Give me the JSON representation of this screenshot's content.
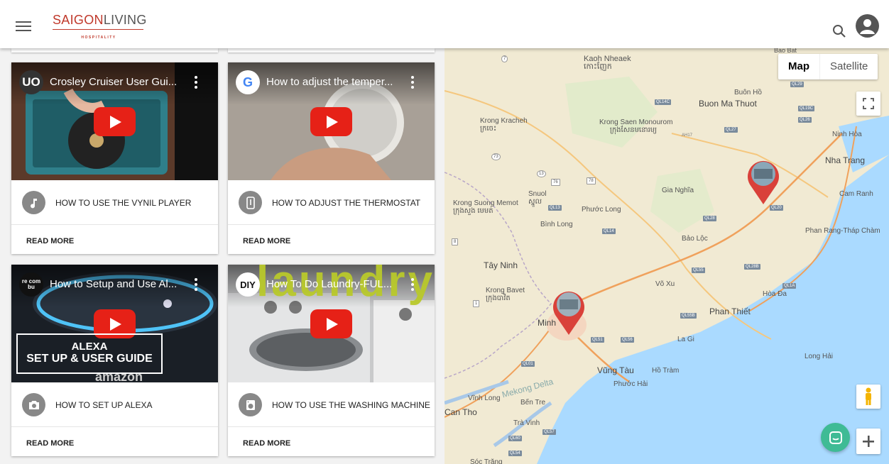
{
  "header": {
    "logo_main_red": "SAIGON",
    "logo_main_rest": "LIVING",
    "logo_sub": "HOSPITALITY"
  },
  "cards": [
    {
      "video_title": "Crosley Cruiser User Gui...",
      "channel_logo": "UO",
      "label": "HOW TO USE THE VYNIL PLAYER",
      "icon": "music-note-icon",
      "read_more": "READ MORE"
    },
    {
      "video_title": "How to adjust the temper...",
      "channel_logo": "G",
      "label": "HOW TO ADJUST THE THERMOSTAT",
      "icon": "thermostat-icon",
      "read_more": "READ MORE"
    },
    {
      "video_title": "How to Setup and Use Al...",
      "channel_logo": "re com bu",
      "overlay_line1": "ALEXA",
      "overlay_line2": "SET UP & USER GUIDE",
      "overlay_brand": "amazon",
      "label": "HOW TO SET UP ALEXA",
      "icon": "camera-icon",
      "read_more": "READ MORE"
    },
    {
      "video_title": "How To Do Laundry-FUL...",
      "channel_logo": "DIY",
      "overlay_word": "laundry",
      "label": "HOW TO USE THE WASHING MACHINE",
      "icon": "washing-machine-icon",
      "read_more": "READ MORE"
    }
  ],
  "map": {
    "type_map": "Map",
    "type_satellite": "Satellite",
    "places": [
      {
        "name": "Kaoh Nheaek",
        "sub": "កោះញែក"
      },
      {
        "name": "Buôn Hồ"
      },
      {
        "name": "Buon Ma Thuot"
      },
      {
        "name": "Krong Kracheh",
        "sub": "ក្រចេះ"
      },
      {
        "name": "Krong Saen Monourom",
        "sub": "ក្រុងសែនមនោរម្យ"
      },
      {
        "name": "Ninh Hòa"
      },
      {
        "name": "Nha Trang"
      },
      {
        "name": "Gia Nghĩa"
      },
      {
        "name": "Snuol",
        "sub": "ស្នួល"
      },
      {
        "name": "Krong Suong Memot",
        "sub": "ក្រុងសួង មេមត់"
      },
      {
        "name": "Phước Long"
      },
      {
        "name": "Cam Ranh"
      },
      {
        "name": "Bình Long"
      },
      {
        "name": "Bảo Lộc"
      },
      {
        "name": "Phan Rang-Tháp Chàm"
      },
      {
        "name": "Tây Ninh"
      },
      {
        "name": "Võ Xu"
      },
      {
        "name": "Krong Bavet",
        "sub": "ក្រុងបាវិត"
      },
      {
        "name": "Hòa Đa"
      },
      {
        "name": "Phan Thiết"
      },
      {
        "name": "Minh"
      },
      {
        "name": "La Gi"
      },
      {
        "name": "Long Hải"
      },
      {
        "name": "Vũng Tàu"
      },
      {
        "name": "Hồ Tràm"
      },
      {
        "name": "Phước Hải"
      },
      {
        "name": "Vĩnh Long"
      },
      {
        "name": "Mekong Delta"
      },
      {
        "name": "Bến Tre"
      },
      {
        "name": "Can Tho"
      },
      {
        "name": "Trà Vinh"
      },
      {
        "name": "Bao Bat"
      },
      {
        "name": "Sóc Trăng"
      }
    ],
    "roads": [
      "QL14C",
      "QL19C",
      "QL26",
      "QL27",
      "QL29",
      "AH17",
      "QL13",
      "QL14",
      "QL28",
      "QL20",
      "QL55",
      "QL28B",
      "QL1A",
      "QL55B",
      "QL51",
      "QL56",
      "QL01",
      "QL57",
      "QL60",
      "QL54",
      "7",
      "73",
      "76",
      "78",
      "13",
      "8",
      "1"
    ]
  }
}
